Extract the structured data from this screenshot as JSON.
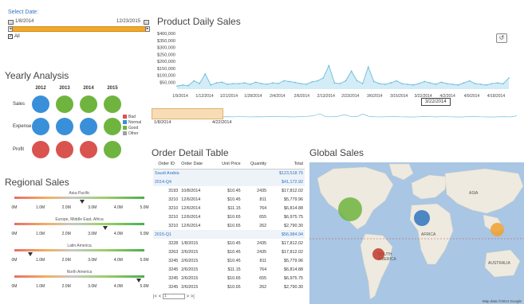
{
  "date_selector": {
    "title": "Select Date:",
    "start": "1/8/2014",
    "end": "12/23/2015",
    "all_label": "All",
    "all_checked": true
  },
  "yearly_analysis": {
    "title": "Yearly Analysis",
    "years": [
      "2012",
      "2013",
      "2014",
      "2015"
    ],
    "rows": [
      {
        "label": "Sales",
        "statuses": [
          "Normal",
          "Good",
          "Good",
          "Good"
        ]
      },
      {
        "label": "Expense",
        "statuses": [
          "Normal",
          "Normal",
          "Normal",
          "Good"
        ]
      },
      {
        "label": "Profit",
        "statuses": [
          "Bad",
          "Bad",
          "Bad",
          "Good"
        ]
      }
    ],
    "legend": [
      {
        "label": "Bad",
        "color": "#d9534f"
      },
      {
        "label": "Normal",
        "color": "#3a8fd9"
      },
      {
        "label": "Good",
        "color": "#6fb43f"
      },
      {
        "label": "Other",
        "color": "#a0a0a0"
      }
    ]
  },
  "regional_sales": {
    "title": "Regional Sales",
    "axis_ticks": [
      "0M",
      "1.0M",
      "2.0M",
      "3.0M",
      "4.0M",
      "5.0M"
    ],
    "regions": [
      {
        "name": "Asia-Pacific",
        "value_m": 2.6
      },
      {
        "name": "Europe, Middle East, Africa",
        "value_m": 3.5
      },
      {
        "name": "Latin America",
        "value_m": 0.6
      },
      {
        "name": "North America",
        "value_m": 4.8
      }
    ]
  },
  "product_daily_sales": {
    "title": "Product Daily Sales",
    "tooltip": "3/22/2014",
    "refresh_icon": "refresh-icon",
    "range_start": "1/8/2014",
    "range_end": "4/22/2014"
  },
  "chart_data": {
    "type": "area",
    "title": "Product Daily Sales",
    "ylim": [
      0,
      400000
    ],
    "y_ticks": [
      "$50,000",
      "$100,000",
      "$150,000",
      "$200,000",
      "$250,000",
      "$300,000",
      "$350,000",
      "$400,000"
    ],
    "x_tick_labels": [
      "1/9/2014",
      "1/12/2014",
      "1/21/2014",
      "1/28/2014",
      "2/4/2014",
      "2/6/2014",
      "2/13/2014",
      "2/23/2014",
      "3/6/2014",
      "3/15/2014",
      "3/22/2014",
      "4/2/2014",
      "4/9/2014",
      "4/18/2014"
    ],
    "values": [
      22000,
      30000,
      25000,
      60000,
      40000,
      110000,
      30000,
      45000,
      50000,
      35000,
      40000,
      40000,
      45000,
      35000,
      50000,
      40000,
      35000,
      45000,
      40000,
      60000,
      55000,
      48000,
      40000,
      35000,
      52000,
      60000,
      80000,
      170000,
      45000,
      40000,
      60000,
      130000,
      60000,
      40000,
      160000,
      55000,
      40000,
      35000,
      45000,
      60000,
      40000,
      35000,
      30000,
      40000,
      55000,
      45000,
      35000,
      50000,
      40000,
      35000,
      30000,
      45000,
      60000,
      40000,
      35000,
      30000,
      40000,
      45000,
      38000,
      80000
    ],
    "grid": false
  },
  "order_table": {
    "title": "Order Detail Table",
    "columns": [
      "Order ID",
      "Order Date",
      "Unit Price",
      "Quantity",
      "Total"
    ],
    "groups": [
      {
        "name": "Saudi Arabia",
        "total": "$123,518.75",
        "header_only": true
      },
      {
        "name": "2014-Q4",
        "total": "$41,172.92",
        "rows": [
          [
            "3193",
            "10/8/2014",
            "$10.45",
            "2435",
            "$17,812.02"
          ],
          [
            "3210",
            "12/6/2014",
            "$10.45",
            "811",
            "$5,779.96"
          ],
          [
            "3210",
            "12/6/2014",
            "$11.15",
            "764",
            "$6,814.88"
          ],
          [
            "3210",
            "12/6/2014",
            "$10.65",
            "655",
            "$6,975.75"
          ],
          [
            "3210",
            "12/6/2014",
            "$10.65",
            "262",
            "$2,790.30"
          ]
        ]
      },
      {
        "name": "2015-Q1",
        "total": "$56,984.94",
        "rows": [
          [
            "3228",
            "1/8/2015",
            "$10.45",
            "2435",
            "$17,812.02"
          ],
          [
            "3263",
            "2/6/2015",
            "$10.45",
            "2435",
            "$17,812.02"
          ],
          [
            "3245",
            "2/6/2015",
            "$10.45",
            "811",
            "$5,779.96"
          ],
          [
            "3245",
            "2/6/2015",
            "$11.15",
            "764",
            "$6,814.88"
          ],
          [
            "3245",
            "2/6/2015",
            "$10.65",
            "655",
            "$6,975.75"
          ],
          [
            "3245",
            "2/6/2015",
            "$10.65",
            "262",
            "$2,790.30"
          ]
        ]
      }
    ],
    "pager_value": "1"
  },
  "global_sales": {
    "title": "Global Sales",
    "map_labels": [
      "ASIA",
      "AFRICA",
      "SOUTH AMERICA",
      "AUSTRALIA"
    ],
    "footer": "Map data ©2014 Google",
    "bubble_colors": [
      "#6fb43f",
      "#2f74c0",
      "#f0a030",
      "#c0392b"
    ]
  }
}
